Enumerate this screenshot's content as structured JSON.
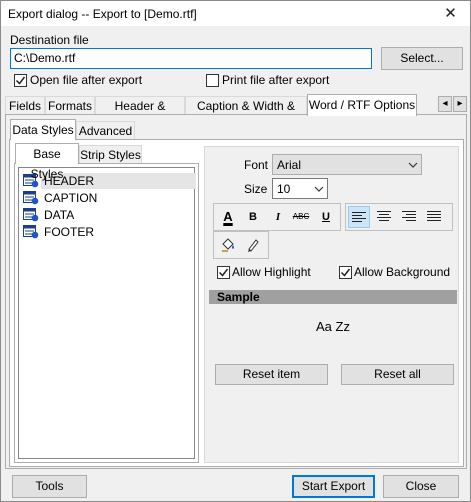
{
  "window": {
    "title": "Export dialog -- Export to [Demo.rtf]",
    "close_glyph": "✕"
  },
  "destination": {
    "label": "Destination file",
    "path": "C:\\Demo.rtf",
    "select_label": "Select...",
    "open_after_label": "Open file after export",
    "open_after_checked": true,
    "print_after_label": "Print file after export",
    "print_after_checked": false
  },
  "main_tabs": [
    {
      "label": "Fields"
    },
    {
      "label": "Formats"
    },
    {
      "label": "Header & Footer"
    },
    {
      "label": "Caption & Width & Align"
    },
    {
      "label": "Word / RTF Options",
      "active": true
    }
  ],
  "scroll_arrows": {
    "left": "◂",
    "right": "▸"
  },
  "style_tabs": [
    {
      "label": "Data Styles",
      "active": true
    },
    {
      "label": "Advanced"
    }
  ],
  "base_tabs": [
    {
      "label": "Base Styles",
      "active": true
    },
    {
      "label": "Strip Styles"
    }
  ],
  "styles_list": [
    {
      "label": "HEADER",
      "selected": true
    },
    {
      "label": "CAPTION"
    },
    {
      "label": "DATA"
    },
    {
      "label": "FOOTER"
    }
  ],
  "font": {
    "label": "Font",
    "value": "Arial",
    "size_label": "Size",
    "size_value": "10"
  },
  "toolbar": {
    "color_glyph": "A",
    "bold_glyph": "B",
    "italic_glyph": "I",
    "strike_glyph": "ABC",
    "underline_glyph": "U",
    "align_left_selected": true
  },
  "options": {
    "allow_highlight_label": "Allow Highlight",
    "allow_highlight_checked": true,
    "allow_background_label": "Allow Background",
    "allow_background_checked": true
  },
  "sample": {
    "header": "Sample",
    "text": "Aa Zz"
  },
  "reset": {
    "item_label": "Reset item",
    "all_label": "Reset all"
  },
  "footer": {
    "tools_label": "Tools",
    "start_label": "Start Export",
    "close_label": "Close"
  },
  "colors": {
    "accent": "#0078d7",
    "sample_header": "#a0a0a0",
    "selection": "#e5e5e5"
  }
}
